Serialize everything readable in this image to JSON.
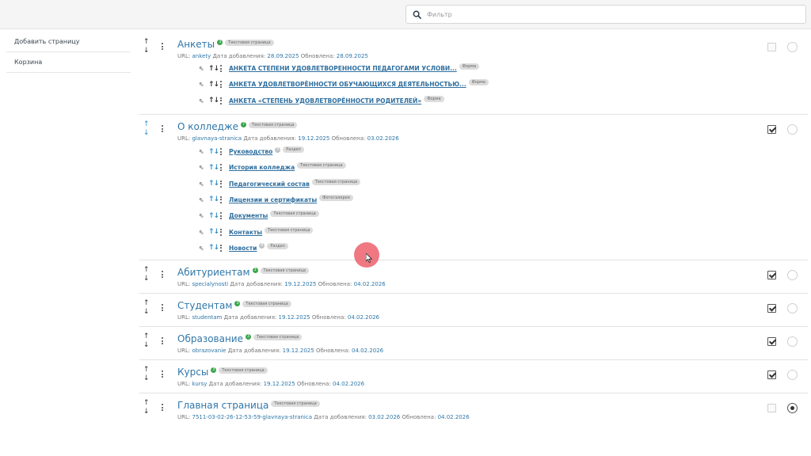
{
  "filter": {
    "placeholder": "Фильтр"
  },
  "sidebar": {
    "items": [
      {
        "label": "Добавить страницу"
      },
      {
        "label": "Корзина"
      }
    ]
  },
  "meta_labels": {
    "url": "URL:",
    "added": "Дата добавления:",
    "updated": "Обновлена:"
  },
  "pages": [
    {
      "title": "Анкеты",
      "count": "3",
      "type": "Текстовая страница",
      "url": "ankety",
      "added": "28.09.2025",
      "updated": "28.09.2025",
      "checked": false,
      "radio": false,
      "children": [
        {
          "label": "АНКЕТА СТЕПЕНИ УДОВЛЕТВОРЕННОСТИ ПЕДАГОГАМИ УСЛОВИ...",
          "tag": "Форма"
        },
        {
          "label": "АНКЕТА УДОВЛЕТВОРЁННОСТИ ОБУЧАЮЩИХСЯ ДЕЯТЕЛЬНОСТЬЮ...",
          "tag": "Форма"
        },
        {
          "label": "АНКЕТА «СТЕПЕНЬ УДОВЛЕТВОРЁННОСТИ РОДИТЕЛЕЙ»",
          "tag": "Форма"
        }
      ]
    },
    {
      "title": "О колледже",
      "count": "7",
      "type": "Текстовая страница",
      "url": "glavnaya-stranica",
      "added": "19.12.2025",
      "updated": "03.02.2026",
      "checked": true,
      "radio": false,
      "children": [
        {
          "label": "Руководство",
          "count": "5",
          "tag": "Раздел"
        },
        {
          "label": "История колледжа",
          "tag": "Текстовая страница"
        },
        {
          "label": "Педагогический состав",
          "tag": "Текстовая страница"
        },
        {
          "label": "Лицензии и сертификаты",
          "tag": "Фотогалерея"
        },
        {
          "label": "Документы",
          "tag": "Текстовая страница"
        },
        {
          "label": "Контакты",
          "tag": "Текстовая страница"
        },
        {
          "label": "Новости",
          "count": "8",
          "tag": "Раздел"
        }
      ]
    },
    {
      "title": "Абитуриентам",
      "count": "3",
      "type": "Текстовая страница",
      "url": "specialynosti",
      "added": "19.12.2025",
      "updated": "04.02.2026",
      "checked": true,
      "radio": false,
      "children": []
    },
    {
      "title": "Студентам",
      "count": "3",
      "type": "Текстовая страница",
      "url": "studentam",
      "added": "19.12.2025",
      "updated": "04.02.2026",
      "checked": true,
      "radio": false,
      "children": []
    },
    {
      "title": "Образование",
      "count": "3",
      "type": "Текстовая страница",
      "url": "obrazovanie",
      "added": "19.12.2025",
      "updated": "04.02.2026",
      "checked": true,
      "radio": false,
      "children": []
    },
    {
      "title": "Курсы",
      "count": "3",
      "type": "Текстовая страница",
      "url": "kursy",
      "added": "19.12.2025",
      "updated": "04.02.2026",
      "checked": true,
      "radio": false,
      "children": []
    },
    {
      "title": "Главная страница",
      "type": "Текстовая страница",
      "url": "7511-03-02-26-12-53-59-glavnaya-stranica",
      "added": "03.02.2026",
      "updated": "04.02.2026",
      "checked": false,
      "radio": true,
      "children": []
    }
  ],
  "colors": {
    "accent": "#2f77a8",
    "count_badge": "#3aa64a",
    "cursor_highlight": "#ec606c"
  }
}
